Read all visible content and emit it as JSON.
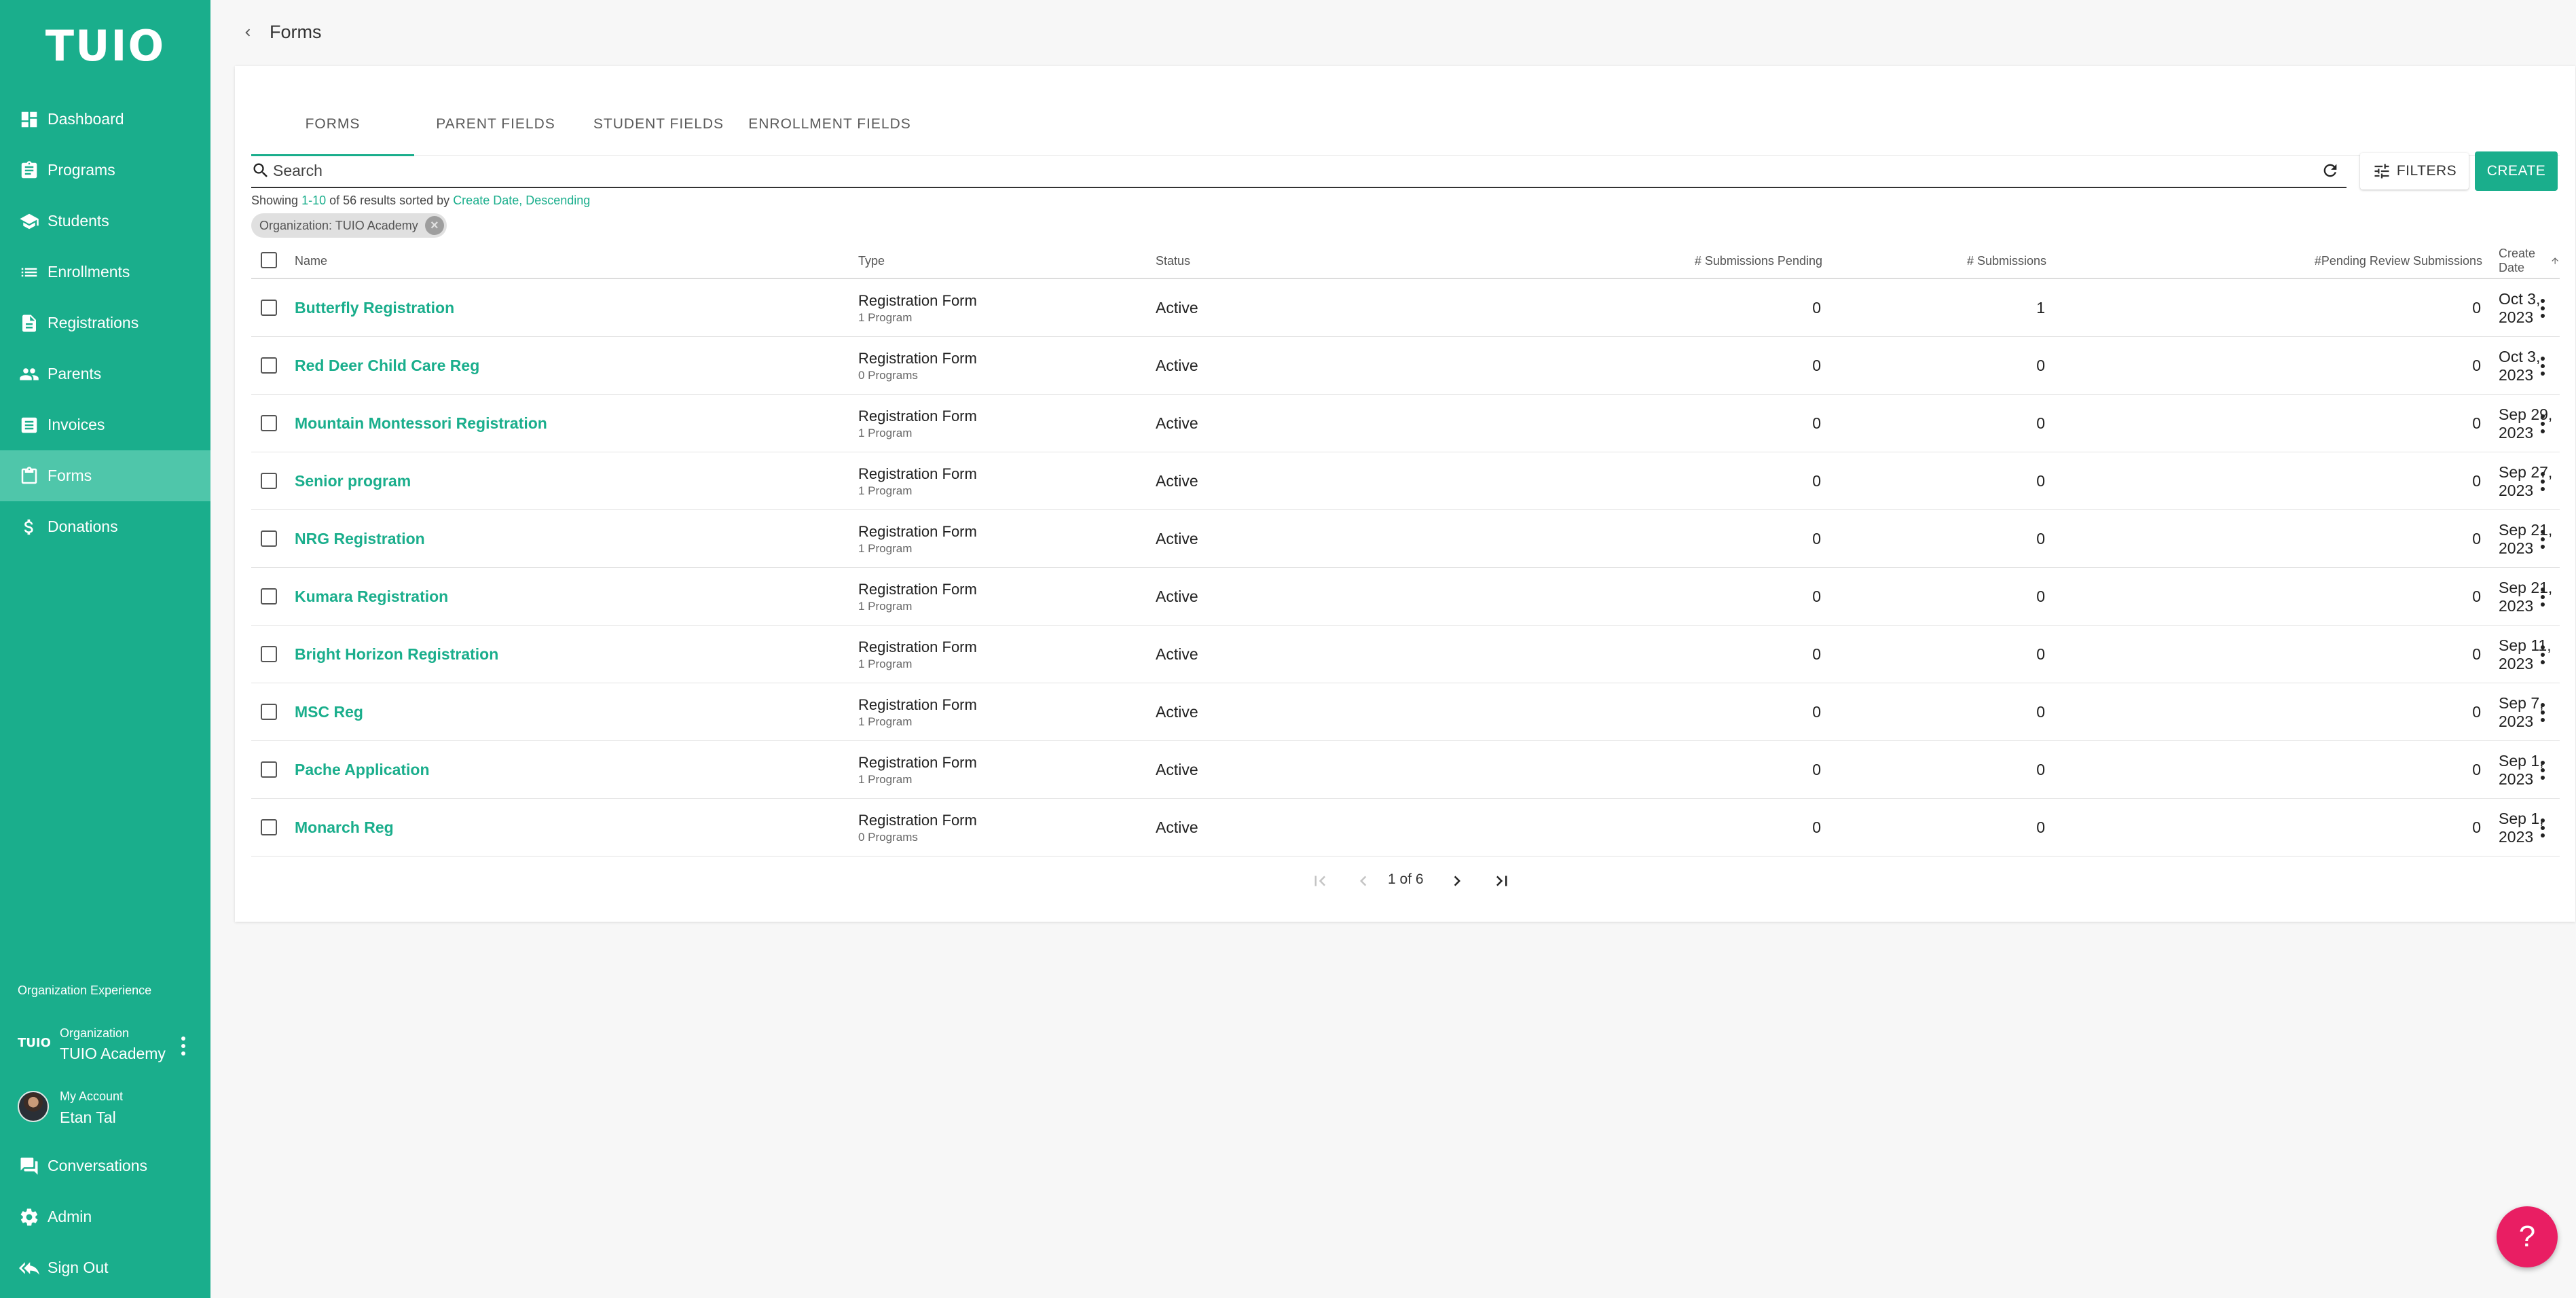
{
  "app": {
    "logo": "TUIO"
  },
  "sidebar": {
    "items": [
      {
        "label": "Dashboard",
        "icon": "dashboard-icon"
      },
      {
        "label": "Programs",
        "icon": "clipboard-icon"
      },
      {
        "label": "Students",
        "icon": "school-icon"
      },
      {
        "label": "Enrollments",
        "icon": "list-icon"
      },
      {
        "label": "Registrations",
        "icon": "document-icon"
      },
      {
        "label": "Parents",
        "icon": "people-icon"
      },
      {
        "label": "Invoices",
        "icon": "invoice-icon"
      },
      {
        "label": "Forms",
        "icon": "form-icon",
        "active": true
      },
      {
        "label": "Donations",
        "icon": "dollar-icon"
      }
    ],
    "org_experience_label": "Organization Experience",
    "organization": {
      "badge": "TUIO",
      "small": "Organization",
      "name": "TUIO Academy"
    },
    "account": {
      "small": "My Account",
      "name": "Etan Tal"
    },
    "bottom_items": [
      {
        "label": "Conversations",
        "icon": "chat-icon"
      },
      {
        "label": "Admin",
        "icon": "gear-icon"
      },
      {
        "label": "Sign Out",
        "icon": "sign-out-icon"
      }
    ]
  },
  "header": {
    "title": "Forms"
  },
  "tabs": [
    "FORMS",
    "PARENT FIELDS",
    "STUDENT FIELDS",
    "ENROLLMENT FIELDS"
  ],
  "search": {
    "placeholder": "Search"
  },
  "toolbar": {
    "filters_label": "FILTERS",
    "create_label": "CREATE"
  },
  "summary": {
    "prefix": "Showing ",
    "range": "1-10",
    "middle": " of 56 results sorted by ",
    "sort": "Create Date, Descending"
  },
  "chip": {
    "label": "Organization: TUIO Academy"
  },
  "table": {
    "columns": {
      "name": "Name",
      "type": "Type",
      "status": "Status",
      "pending": "# Submissions Pending",
      "submissions": "# Submissions",
      "review": "#Pending Review Submissions",
      "create_date": "Create Date"
    },
    "rows": [
      {
        "name": "Butterfly Registration",
        "type": "Registration Form",
        "programs": "1 Program",
        "status": "Active",
        "pending": "0",
        "submissions": "1",
        "review": "0",
        "date": "Oct 3, 2023"
      },
      {
        "name": "Red Deer Child Care Reg",
        "type": "Registration Form",
        "programs": "0 Programs",
        "status": "Active",
        "pending": "0",
        "submissions": "0",
        "review": "0",
        "date": "Oct 3, 2023"
      },
      {
        "name": "Mountain Montessori Registration",
        "type": "Registration Form",
        "programs": "1 Program",
        "status": "Active",
        "pending": "0",
        "submissions": "0",
        "review": "0",
        "date": "Sep 29, 2023"
      },
      {
        "name": "Senior program",
        "type": "Registration Form",
        "programs": "1 Program",
        "status": "Active",
        "pending": "0",
        "submissions": "0",
        "review": "0",
        "date": "Sep 27, 2023"
      },
      {
        "name": "NRG Registration",
        "type": "Registration Form",
        "programs": "1 Program",
        "status": "Active",
        "pending": "0",
        "submissions": "0",
        "review": "0",
        "date": "Sep 21, 2023"
      },
      {
        "name": "Kumara Registration",
        "type": "Registration Form",
        "programs": "1 Program",
        "status": "Active",
        "pending": "0",
        "submissions": "0",
        "review": "0",
        "date": "Sep 21, 2023"
      },
      {
        "name": "Bright Horizon Registration",
        "type": "Registration Form",
        "programs": "1 Program",
        "status": "Active",
        "pending": "0",
        "submissions": "0",
        "review": "0",
        "date": "Sep 11, 2023"
      },
      {
        "name": "MSC Reg",
        "type": "Registration Form",
        "programs": "1 Program",
        "status": "Active",
        "pending": "0",
        "submissions": "0",
        "review": "0",
        "date": "Sep 7, 2023"
      },
      {
        "name": "Pache Application",
        "type": "Registration Form",
        "programs": "1 Program",
        "status": "Active",
        "pending": "0",
        "submissions": "0",
        "review": "0",
        "date": "Sep 1, 2023"
      },
      {
        "name": "Monarch Reg",
        "type": "Registration Form",
        "programs": "0 Programs",
        "status": "Active",
        "pending": "0",
        "submissions": "0",
        "review": "0",
        "date": "Sep 1, 2023"
      }
    ]
  },
  "pagination": {
    "label": "1 of 6"
  },
  "help": {
    "label": "?"
  },
  "colors": {
    "brand": "#1aae8c",
    "sidebar_active": "#4fc6aa",
    "help": "#e91e63"
  }
}
